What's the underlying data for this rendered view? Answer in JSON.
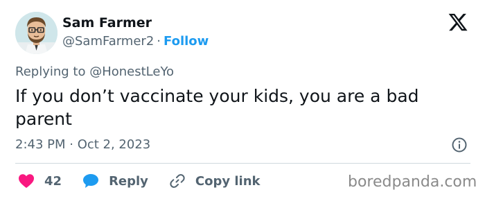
{
  "author": {
    "name": "Sam Farmer",
    "handle": "@SamFarmer2",
    "separator": "·",
    "follow_label": "Follow",
    "avatar_icon": "cartoon-man-avatar"
  },
  "platform_logo_icon": "x-logo-icon",
  "reply_context": "Replying to @HonestLeYo",
  "tweet_text": "If you don’t vaccinate your kids, you are a bad parent",
  "timestamp": "2:43 PM · Oct 2, 2023",
  "actions": {
    "likes_count": "42",
    "reply_label": "Reply",
    "copy_link_label": "Copy link"
  },
  "watermark": "boredpanda.com",
  "colors": {
    "accent_blue": "#1d9bf0",
    "like_red": "#f91880",
    "text_primary": "#0f1419",
    "text_secondary": "#536471"
  }
}
